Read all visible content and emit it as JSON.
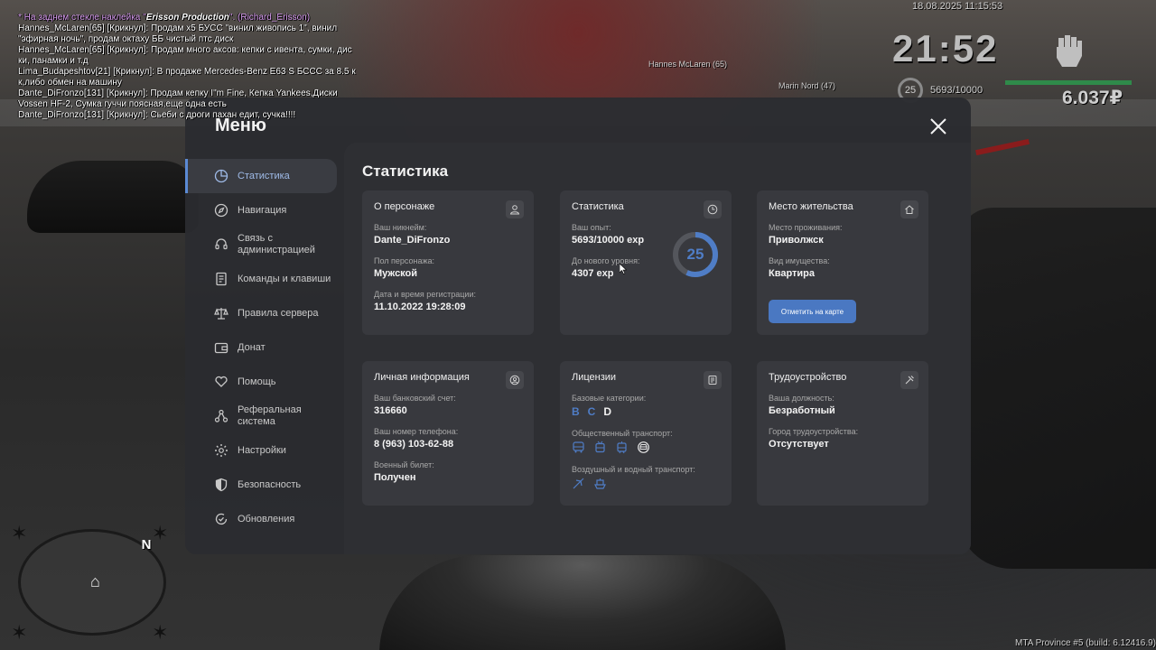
{
  "chat": [
    {
      "text": "* На заднем стекле наклейка \"",
      "bold": "Erisson Production",
      "tail": "\". (Richard_Erisson)",
      "style": "pink"
    },
    {
      "text": "Hannes_McLaren[65] [Крикнул]: Продам x5 БУСС \"винил живопись 1\", винил"
    },
    {
      "text": "\"эфирная ночь\", продам октаху ББ чистый птс диск"
    },
    {
      "text": "Hannes_McLaren[65] [Крикнул]: Продам много аксов: кепки с ивента, сумки, дис"
    },
    {
      "text": "ки, панамки и т.д"
    },
    {
      "text": "Lima_Budapeshtov[21] [Крикнул]: В продаже Mercedes-Benz E63 S БССС за 8.5 к"
    },
    {
      "text": "к,либо обмен на машину"
    },
    {
      "text": "Dante_DiFronzo[131] [Крикнул]: Продам кепку I\"m Fine, Кепка Yankees,Диски"
    },
    {
      "text": " Vossen HF-2, Сумка гуччи поясная,еще одна есть"
    },
    {
      "text": "Dante_DiFronzo[131] [Крикнул]: Сьеби с дроги пахан едит, сучка!!!!"
    }
  ],
  "hud": {
    "date": "18.08.2025 11:15:53",
    "time": "21:52",
    "level": "25",
    "exp": "5693/10000",
    "exp_fraction": 0.5693,
    "money": "6.037₽",
    "nametag_1": "Hannes McLaren (65)",
    "nametag_2": "Marin Nord (47)",
    "radar_north": "N",
    "build": "MTA Province #5 (build: 6.12416.9)"
  },
  "menu": {
    "title": "Меню",
    "sidebar": [
      {
        "label": "Статистика",
        "icon": "pie-chart-icon",
        "active": true
      },
      {
        "label": "Навигация",
        "icon": "compass-icon"
      },
      {
        "label": "Связь с администрацией",
        "icon": "headset-icon"
      },
      {
        "label": "Команды и клавиши",
        "icon": "document-icon"
      },
      {
        "label": "Правила сервера",
        "icon": "scales-icon"
      },
      {
        "label": "Донат",
        "icon": "wallet-icon"
      },
      {
        "label": "Помощь",
        "icon": "heart-hand-icon"
      },
      {
        "label": "Реферальная система",
        "icon": "network-icon"
      },
      {
        "label": "Настройки",
        "icon": "gear-icon"
      },
      {
        "label": "Безопасность",
        "icon": "shield-icon"
      },
      {
        "label": "Обновления",
        "icon": "refresh-check-icon"
      }
    ],
    "page_title": "Статистика",
    "cards": {
      "character": {
        "title": "О персонаже",
        "nick_label": "Ваш никнейм:",
        "nick": "Dante_DiFronzo",
        "sex_label": "Пол персонажа:",
        "sex": "Мужской",
        "reg_label": "Дата и время регистрации:",
        "reg": "11.10.2022 19:28:09"
      },
      "stats": {
        "title": "Статистика",
        "exp_label": "Ваш опыт:",
        "exp": "5693/10000 exp",
        "next_label": "До нового уровня:",
        "next": "4307 exp",
        "level": "25",
        "progress": 0.5693
      },
      "residence": {
        "title": "Место жительства",
        "place_label": "Место проживания:",
        "place": "Приволжск",
        "property_label": "Вид имущества:",
        "property": "Квартира",
        "map_button": "Отметить на карте"
      },
      "personal": {
        "title": "Личная информация",
        "bank_label": "Ваш банковский счет:",
        "bank": "316660",
        "phone_label": "Ваш номер телефона:",
        "phone": "8 (963) 103-62-88",
        "military_label": "Военный билет:",
        "military": "Получен"
      },
      "licenses": {
        "title": "Лицензии",
        "base_label": "Базовые категории:",
        "categories": [
          {
            "name": "B",
            "owned": true
          },
          {
            "name": "C",
            "owned": true
          },
          {
            "name": "D",
            "owned": false
          }
        ],
        "public_label": "Общественный транспорт:",
        "air_label": "Воздушный и водный транспорт:"
      },
      "job": {
        "title": "Трудоустройство",
        "position_label": "Ваша должность:",
        "position": "Безработный",
        "city_label": "Город трудоустройства:",
        "city": "Отсутствует"
      }
    }
  },
  "colors": {
    "accent": "#4f7dc6",
    "panel": "#2b2c30",
    "card": "#38393e",
    "chat_pink": "#d99cf2",
    "health_bar": "#2f8a4a"
  }
}
